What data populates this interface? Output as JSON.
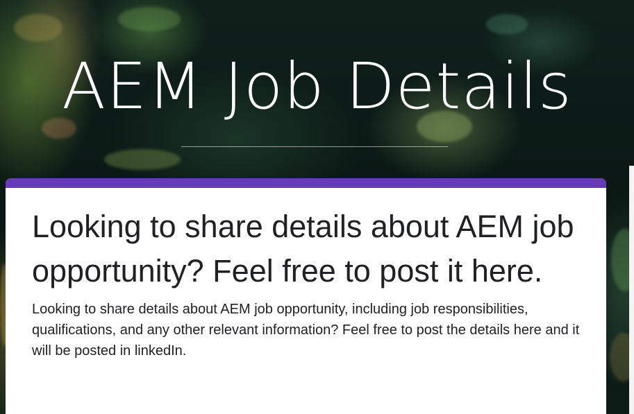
{
  "header": {
    "title": "AEM Job Details"
  },
  "form": {
    "accent_color": "#673ab7",
    "heading": "Looking to share details about AEM job opportunity? Feel free to post it here.",
    "description": "Looking to share details about AEM job opportunity, including job responsibilities, qualifications, and any other relevant information? Feel free to post the details here and it will be posted in linkedIn."
  }
}
